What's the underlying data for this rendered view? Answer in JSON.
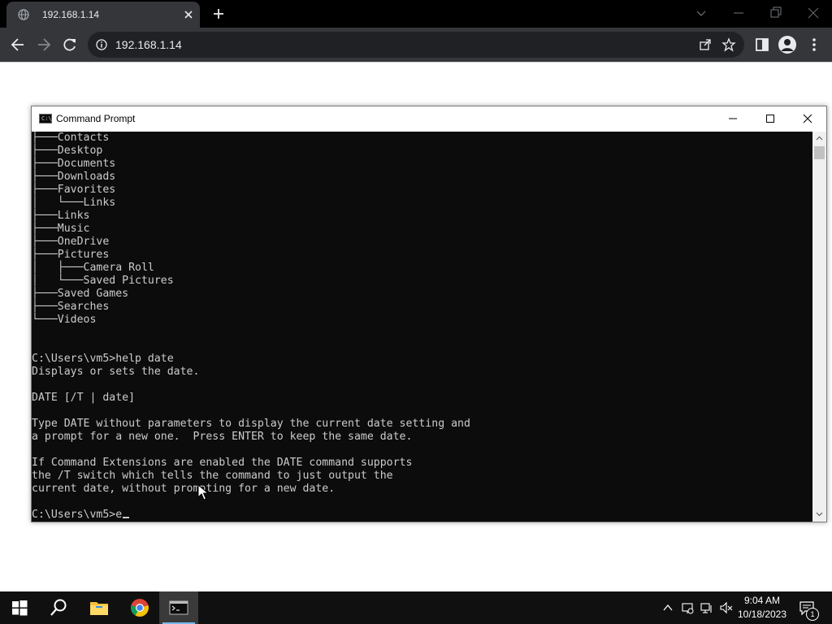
{
  "browser": {
    "tab_title": "192.168.1.14",
    "address": "192.168.1.14",
    "colors": {
      "tabbar": "#000000",
      "toolbar": "#35363a",
      "omnibox": "#202124"
    }
  },
  "cmd": {
    "title": "Command Prompt",
    "lines": [
      "├───Contacts",
      "├───Desktop",
      "├───Documents",
      "├───Downloads",
      "├───Favorites",
      "│   └───Links",
      "├───Links",
      "├───Music",
      "├───OneDrive",
      "├───Pictures",
      "│   ├───Camera Roll",
      "│   └───Saved Pictures",
      "├───Saved Games",
      "├───Searches",
      "└───Videos",
      "",
      "",
      "C:\\Users\\vm5>help date",
      "Displays or sets the date.",
      "",
      "DATE [/T | date]",
      "",
      "Type DATE without parameters to display the current date setting and",
      "a prompt for a new one.  Press ENTER to keep the same date.",
      "",
      "If Command Extensions are enabled the DATE command supports",
      "the /T switch which tells the command to just output the",
      "current date, without prompting for a new date.",
      ""
    ],
    "prompt_line": "C:\\Users\\vm5>e",
    "colors": {
      "background": "#0c0c0c",
      "text": "#cccccc"
    }
  },
  "taskbar": {
    "time": "9:04 AM",
    "date": "10/18/2023",
    "notification_count": "1",
    "items": [
      "start-button",
      "search-icon",
      "file-explorer-icon",
      "chrome-icon",
      "command-prompt-icon"
    ]
  }
}
